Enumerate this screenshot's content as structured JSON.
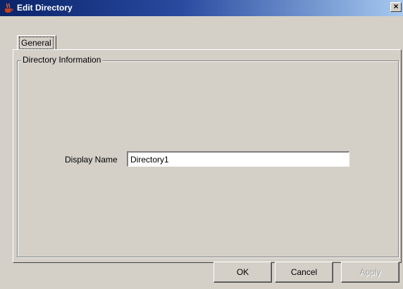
{
  "window": {
    "title": "Edit Directory",
    "close_symbol": "×",
    "app_icon": "java-cup-icon"
  },
  "tabs": [
    {
      "label": "General",
      "selected": true
    }
  ],
  "group": {
    "title": "Directory Information"
  },
  "fields": {
    "display_name": {
      "label": "Display Name",
      "value": "Directory1"
    }
  },
  "buttons": {
    "ok": "OK",
    "cancel": "Cancel",
    "apply": "Apply",
    "apply_enabled": false
  },
  "colors": {
    "titlebar_start": "#0a246a",
    "titlebar_end": "#a6caf0",
    "face": "#d4d0c8",
    "disabled_text": "#a0a0a0"
  }
}
